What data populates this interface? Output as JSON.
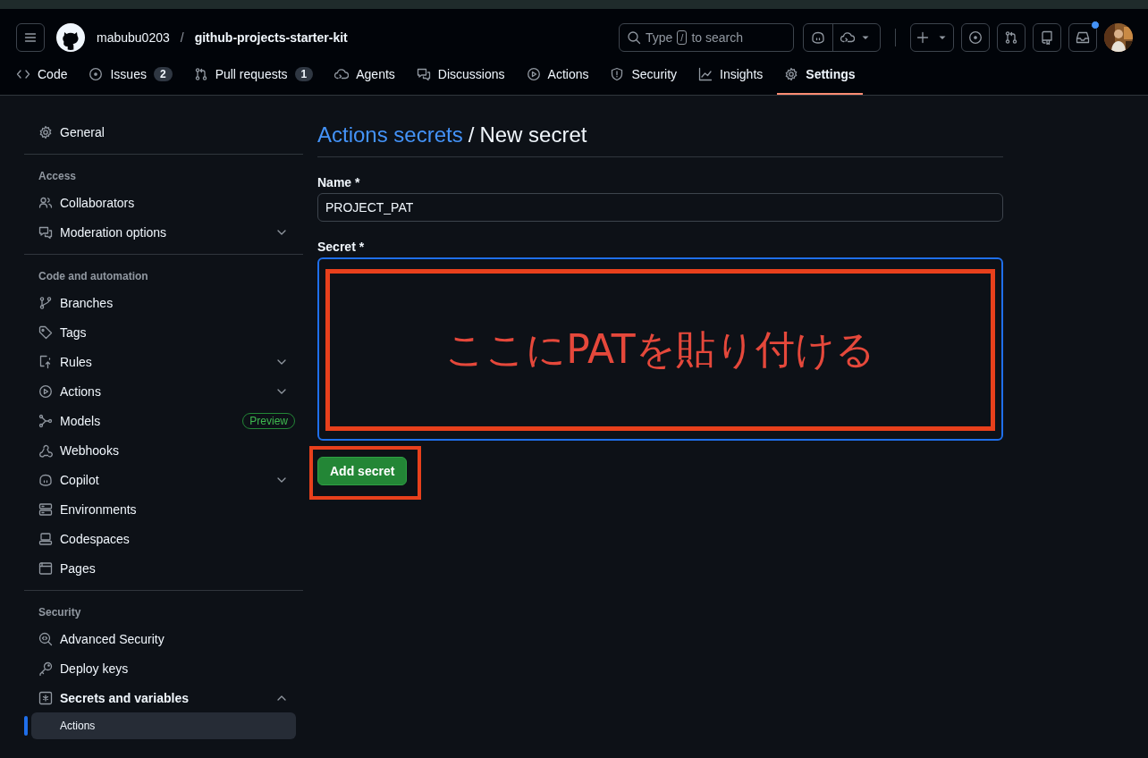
{
  "header": {
    "owner": "mabubu0203",
    "separator": "/",
    "repo": "github-projects-starter-kit",
    "search": {
      "before": "Type",
      "key": "/",
      "after": "to search"
    },
    "inbox_unread": true
  },
  "tabs": [
    {
      "label": "Code",
      "selected": false
    },
    {
      "label": "Issues",
      "counter": "2",
      "selected": false
    },
    {
      "label": "Pull requests",
      "counter": "1",
      "selected": false
    },
    {
      "label": "Agents",
      "selected": false
    },
    {
      "label": "Discussions",
      "selected": false
    },
    {
      "label": "Actions",
      "selected": false
    },
    {
      "label": "Security",
      "selected": false
    },
    {
      "label": "Insights",
      "selected": false
    },
    {
      "label": "Settings",
      "selected": true
    }
  ],
  "sidebar": {
    "sections": [
      {
        "items": [
          {
            "label": "General",
            "kind": "link",
            "selected": false
          }
        ]
      },
      {
        "heading": "Access",
        "items": [
          {
            "label": "Collaborators",
            "kind": "link",
            "selected": false
          },
          {
            "label": "Moderation options",
            "kind": "group",
            "expanded": false,
            "selected": false
          }
        ]
      },
      {
        "heading": "Code and automation",
        "items": [
          {
            "label": "Branches",
            "kind": "link",
            "selected": false
          },
          {
            "label": "Tags",
            "kind": "link",
            "selected": false
          },
          {
            "label": "Rules",
            "kind": "group",
            "expanded": false,
            "selected": false
          },
          {
            "label": "Actions",
            "kind": "group",
            "expanded": false,
            "selected": false
          },
          {
            "label": "Models",
            "kind": "link",
            "badge": "Preview",
            "selected": false
          },
          {
            "label": "Webhooks",
            "kind": "link",
            "selected": false
          },
          {
            "label": "Copilot",
            "kind": "group",
            "expanded": false,
            "selected": false
          },
          {
            "label": "Environments",
            "kind": "link",
            "selected": false
          },
          {
            "label": "Codespaces",
            "kind": "link",
            "selected": false
          },
          {
            "label": "Pages",
            "kind": "link",
            "selected": false
          }
        ]
      },
      {
        "heading": "Security",
        "items": [
          {
            "label": "Advanced Security",
            "kind": "link",
            "selected": false
          },
          {
            "label": "Deploy keys",
            "kind": "link",
            "selected": false
          },
          {
            "label": "Secrets and variables",
            "kind": "group",
            "expanded": true,
            "selected": false,
            "children": [
              {
                "label": "Actions",
                "selected": true
              }
            ]
          }
        ]
      }
    ]
  },
  "main": {
    "breadcrumb_link": "Actions secrets",
    "breadcrumb_separator": "/",
    "title": "New secret",
    "name_field": {
      "label": "Name *",
      "value": "PROJECT_PAT"
    },
    "secret_field": {
      "label": "Secret *",
      "focused": true
    },
    "submit_button": "Add secret"
  },
  "annotation": {
    "text": "ここにPATを貼り付ける"
  }
}
